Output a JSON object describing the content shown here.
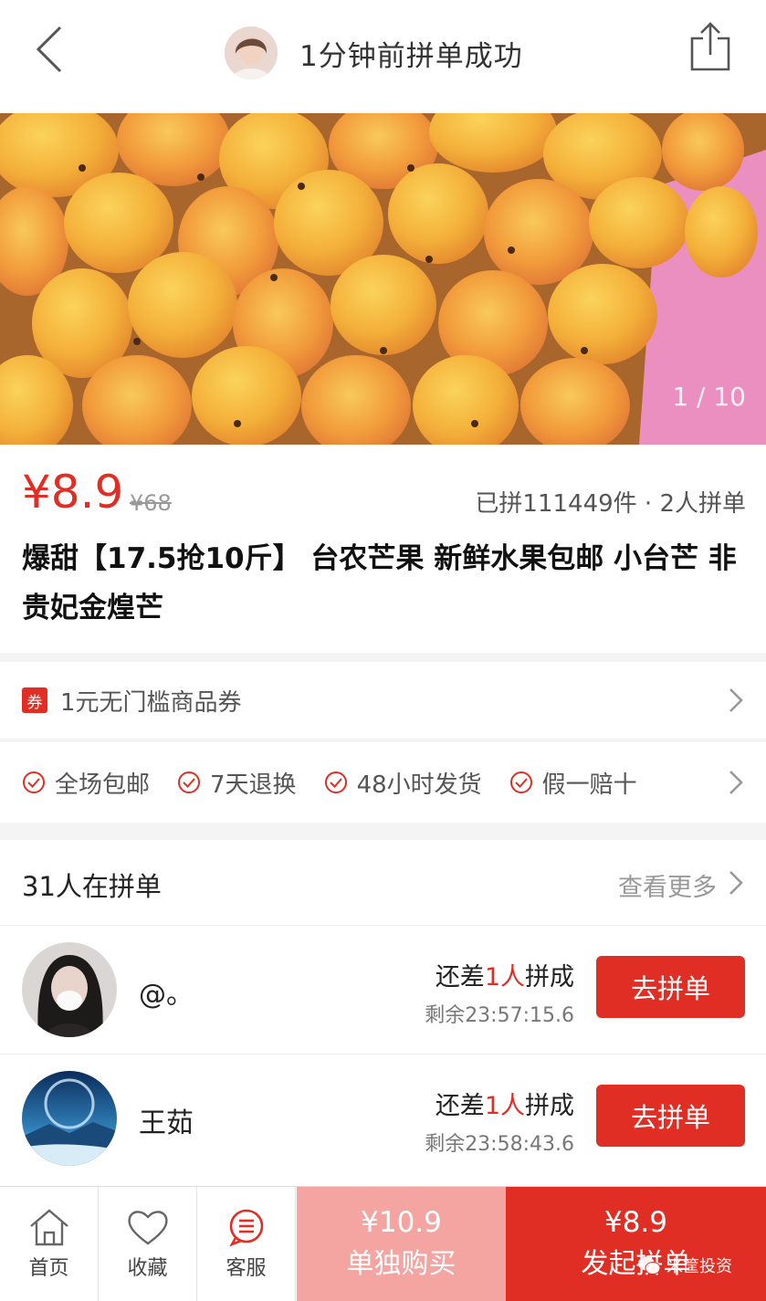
{
  "header": {
    "title": "1分钟前拼单成功",
    "back_icon": "back-arrow-icon",
    "share_icon": "share-icon"
  },
  "gallery": {
    "counter": "1 / 10"
  },
  "product": {
    "price": "¥8.9",
    "original_price": "¥68",
    "sold_info": "已拼111449件 · 2人拼单",
    "title": "爆甜【17.5抢10斤】 台农芒果 新鲜水果包邮 小台芒 非贵妃金煌芒"
  },
  "coupon": {
    "tag": "券",
    "text": "1元无门槛商品券"
  },
  "services": [
    {
      "label": "全场包邮"
    },
    {
      "label": "7天退换"
    },
    {
      "label": "48小时发货"
    },
    {
      "label": "假一赔十"
    }
  ],
  "group": {
    "title": "31人在拼单",
    "more": "查看更多",
    "rows": [
      {
        "name": "@。",
        "need_prefix": "还差",
        "need_count": "1人",
        "need_suffix": "拼成",
        "remaining": "剩余23:57:15.6",
        "button": "去拼单"
      },
      {
        "name": "王茹",
        "need_prefix": "还差",
        "need_count": "1人",
        "need_suffix": "拼成",
        "remaining": "剩余23:58:43.6",
        "button": "去拼单"
      }
    ]
  },
  "bottom_bar": {
    "home": "首页",
    "favorite": "收藏",
    "service": "客服",
    "buy_alone_price": "¥10.9",
    "buy_alone_label": "单独购买",
    "buy_group_price": "¥8.9",
    "buy_group_label": "发起拼单"
  },
  "watermark": "米筐投资",
  "colors": {
    "accent": "#e02e24",
    "accent_light": "#f4a5a1"
  }
}
